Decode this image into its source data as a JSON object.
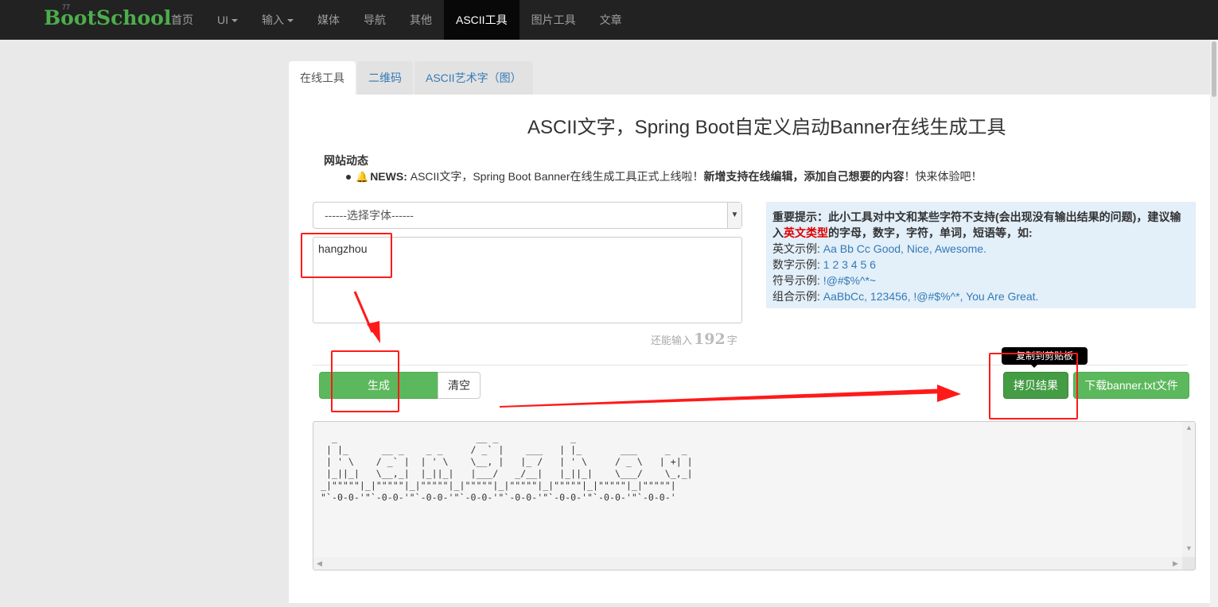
{
  "navbar": {
    "brand": "BootSchool",
    "brand_ghost": "77",
    "items": [
      {
        "label": "首页",
        "has_caret": false,
        "active": false
      },
      {
        "label": "UI",
        "has_caret": true,
        "active": false
      },
      {
        "label": "输入",
        "has_caret": true,
        "active": false
      },
      {
        "label": "媒体",
        "has_caret": false,
        "active": false
      },
      {
        "label": "导航",
        "has_caret": false,
        "active": false
      },
      {
        "label": "其他",
        "has_caret": false,
        "active": false
      },
      {
        "label": "ASCII工具",
        "has_caret": false,
        "active": true
      },
      {
        "label": "图片工具",
        "has_caret": false,
        "active": false
      },
      {
        "label": "文章",
        "has_caret": false,
        "active": false
      }
    ]
  },
  "tabs": [
    {
      "label": "在线工具",
      "active": true
    },
    {
      "label": "二维码",
      "active": false
    },
    {
      "label": "ASCII艺术字（图）",
      "active": false
    }
  ],
  "page_title": "ASCII文字，Spring Boot自定义启动Banner在线生成工具",
  "news": {
    "heading": "网站动态",
    "icon": "bell-icon",
    "tag": "NEWS:",
    "text": "ASCII文字，Spring Boot Banner在线生成工具正式上线啦！",
    "bold": "新增支持在线编辑，添加自己想要的内容",
    "tail": "！快来体验吧！"
  },
  "font_select": {
    "value": "------选择字体------"
  },
  "input": {
    "value": "hangzhou"
  },
  "counter": {
    "prefix": "还能输入",
    "remaining": "192",
    "suffix": "字"
  },
  "hint": {
    "title": "重要提示：",
    "line1": "此小工具对中文和某些字符不支持(会出现没有输出结果的问题)，建议输入",
    "highlight": "英文类型",
    "line1_tail": "的字母，数字，字符，单词，短语等，如:",
    "examples": [
      {
        "label": "英文示例:",
        "value": "Aa Bb Cc Good, Nice, Awesome."
      },
      {
        "label": "数字示例:",
        "value": "1 2 3 4 5 6"
      },
      {
        "label": "符号示例:",
        "value": "!@#$%^*~"
      },
      {
        "label": "组合示例:",
        "value": "AaBbCc, 123456, !@#$%^*, You Are Great."
      }
    ]
  },
  "buttons": {
    "generate": "生成",
    "clear": "清空",
    "copy": "拷贝结果",
    "download": "下载banner.txt文件",
    "copy_tooltip": "复制到剪贴板"
  },
  "output": {
    "text": "  _                         __ _             _\n | |_      __ _    _ _     / _` |    ___   | |_       ___     _  _\n | ' \\    / _` |  | ' \\    \\__, |   |_ /   | ' \\     / _ \\   | +| |\n |_||_|   \\__,_|  |_||_|   |___/   _/__|   |_||_|    \\___/    \\_,_|\n_|\"\"\"\"\"|_|\"\"\"\"\"|_|\"\"\"\"\"|_|\"\"\"\"\"|_|\"\"\"\"\"|_|\"\"\"\"\"|_|\"\"\"\"\"|_|\"\"\"\"\"|\n\"`-0-0-'\"`-0-0-'\"`-0-0-'\"`-0-0-'\"`-0-0-'\"`-0-0-'\"`-0-0-'\"`-0-0-'"
  },
  "colors": {
    "navbar": "#222222",
    "brand": "#4cae4c",
    "success": "#5cb85c",
    "link": "#337ab7",
    "annotation": "#ff1a1a",
    "hint_bg": "#e3eff9"
  }
}
